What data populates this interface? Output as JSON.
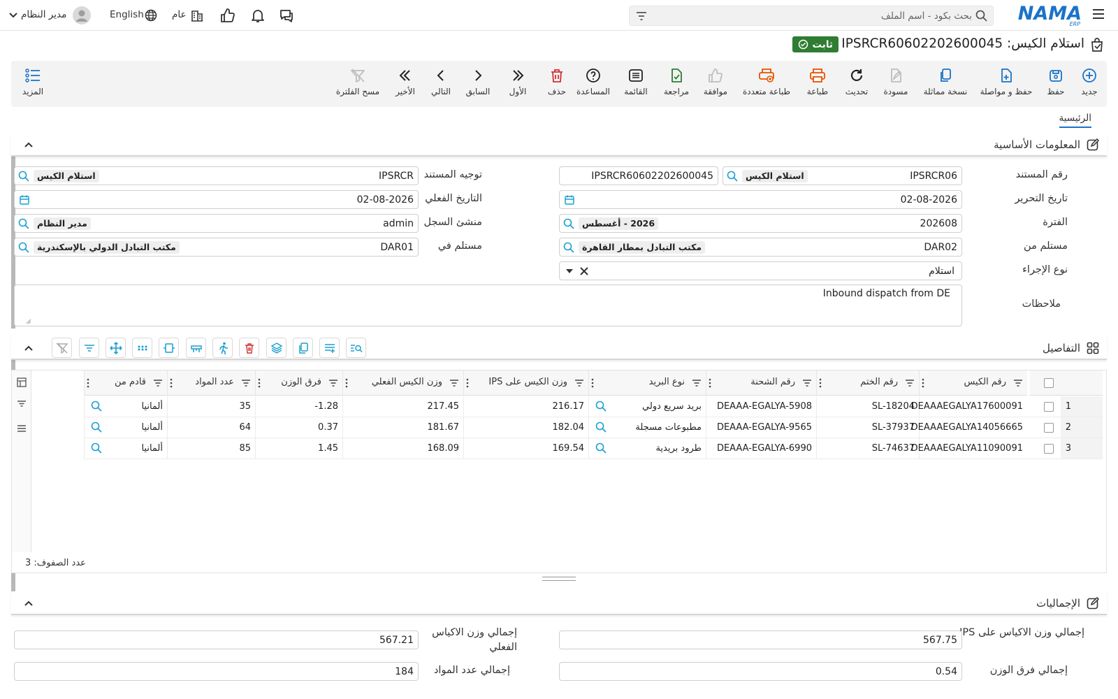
{
  "header": {
    "search_placeholder": "بحث بكود - اسم الملف",
    "language": "English",
    "company": "عام",
    "user": "مدير النظام",
    "logo_text": "NAMA",
    "logo_sub": "ERP"
  },
  "document": {
    "title": "استلام الكيس: IPSRCR60602202600045",
    "status": "ثابت"
  },
  "toolbar": [
    {
      "key": "new",
      "label": "جديد",
      "icon": "plus-circle-icon"
    },
    {
      "key": "save",
      "label": "حفظ",
      "icon": "save-icon"
    },
    {
      "key": "save-continue",
      "label": "حفظ و مواصلة",
      "icon": "save-continue-icon"
    },
    {
      "key": "duplicate",
      "label": "نسخة مماثلة",
      "icon": "copy-icon"
    },
    {
      "key": "draft",
      "label": "مسودة",
      "icon": "draft-icon"
    },
    {
      "key": "refresh",
      "label": "تحديث",
      "icon": "refresh-icon"
    },
    {
      "key": "print",
      "label": "طباعة",
      "icon": "print-icon"
    },
    {
      "key": "multi-print",
      "label": "طباعة متعددة",
      "icon": "multi-print-icon"
    },
    {
      "key": "approve",
      "label": "موافقة",
      "icon": "thumbs-up-icon"
    },
    {
      "key": "review",
      "label": "مراجعة",
      "icon": "review-icon"
    },
    {
      "key": "list",
      "label": "القائمة",
      "icon": "list-icon"
    },
    {
      "key": "help",
      "label": "المساعدة",
      "icon": "help-icon"
    },
    {
      "key": "delete",
      "label": "حذف",
      "icon": "trash-icon"
    },
    {
      "key": "first",
      "label": "الأول",
      "icon": "chevrons-right-icon"
    },
    {
      "key": "previous",
      "label": "السابق",
      "icon": "chevron-right-icon"
    },
    {
      "key": "next",
      "label": "التالي",
      "icon": "chevron-left-icon"
    },
    {
      "key": "last",
      "label": "الأخير",
      "icon": "chevrons-left-icon"
    },
    {
      "key": "clear-filter",
      "label": "مسح الفلترة",
      "icon": "filter-off-icon"
    }
  ],
  "more_label": "المزيد",
  "tabs": {
    "main": "الرئيسية"
  },
  "basic_info": {
    "section_title": "المعلومات الأساسية",
    "doc_number_label": "رقم المستند",
    "doc_number_code": "IPSRCR06",
    "doc_number_type": "استلام الكيس",
    "doc_number_full": "IPSRCR60602202600045",
    "doc_direction_label": "توجيه المستند",
    "doc_direction_code": "IPSRCR",
    "doc_direction_name": "استلام الكيس",
    "edit_date_label": "تاريخ التحرير",
    "edit_date": "02-08-2026",
    "actual_date_label": "التاريخ الفعلي",
    "actual_date": "02-08-2026",
    "period_label": "الفترة",
    "period_code": "202608",
    "period_name": "2026 - أغسطس",
    "creator_label": "منشئ السجل",
    "creator_code": "admin",
    "creator_name": "مدير النظام",
    "received_from_label": "مستلم من",
    "received_from_code": "DAR02",
    "received_from_name": "مكتب التبادل بمطار القاهرة",
    "received_at_label": "مستلم في",
    "received_at_code": "DAR01",
    "received_at_name": "مكتب التبادل الدولي بالإسكندرية",
    "action_type_label": "نوع الإجراء",
    "action_type": "استلام",
    "notes_label": "ملاحظات",
    "notes": "Inbound dispatch from DE"
  },
  "details": {
    "section_title": "التفاصيل",
    "columns": [
      "رقم الكيس",
      "رقم الختم",
      "رقم الشحنة",
      "نوع البريد",
      "وزن الكيس على IPS",
      "وزن الكيس الفعلي",
      "فرق الوزن",
      "عدد المواد",
      "قادم من"
    ],
    "rows": [
      {
        "num": "1",
        "bag": "DEAAAEGALYA17600091",
        "seal": "SL-18204",
        "shipment": "DEAAA-EGALYA-5908",
        "mail_type": "بريد سريع دولي",
        "ips_weight": "216.17",
        "actual_weight": "217.45",
        "diff": "-1.28",
        "items": "35",
        "origin": "ألمانيا"
      },
      {
        "num": "2",
        "bag": "DEAAAEGALYA14056665",
        "seal": "SL-37937",
        "shipment": "DEAAA-EGALYA-9565",
        "mail_type": "مطبوعات مسجلة",
        "ips_weight": "182.04",
        "actual_weight": "181.67",
        "diff": "0.37",
        "items": "64",
        "origin": "ألمانيا"
      },
      {
        "num": "3",
        "bag": "DEAAAEGALYA11090091",
        "seal": "SL-74637",
        "shipment": "DEAAA-EGALYA-6990",
        "mail_type": "طرود بريدية",
        "ips_weight": "169.54",
        "actual_weight": "168.09",
        "diff": "1.45",
        "items": "85",
        "origin": "ألمانيا"
      }
    ],
    "row_count_label": "عدد الصفوف: 3"
  },
  "totals": {
    "section_title": "الإجماليات",
    "ips_weight_label": "إجمالي وزن الاكياس على IPS",
    "ips_weight": "567.75",
    "actual_weight_label": "إجمالي وزن الاكياس الفعلي",
    "actual_weight": "567.21",
    "diff_label": "إجمالي فرق الوزن",
    "diff": "0.54",
    "items_label": "إجمالي عدد المواد",
    "items": "184"
  },
  "colors": {
    "accent": "#1a73c8",
    "status": "#2e7d32",
    "print": "#e65100",
    "delete": "#d32f2f"
  }
}
